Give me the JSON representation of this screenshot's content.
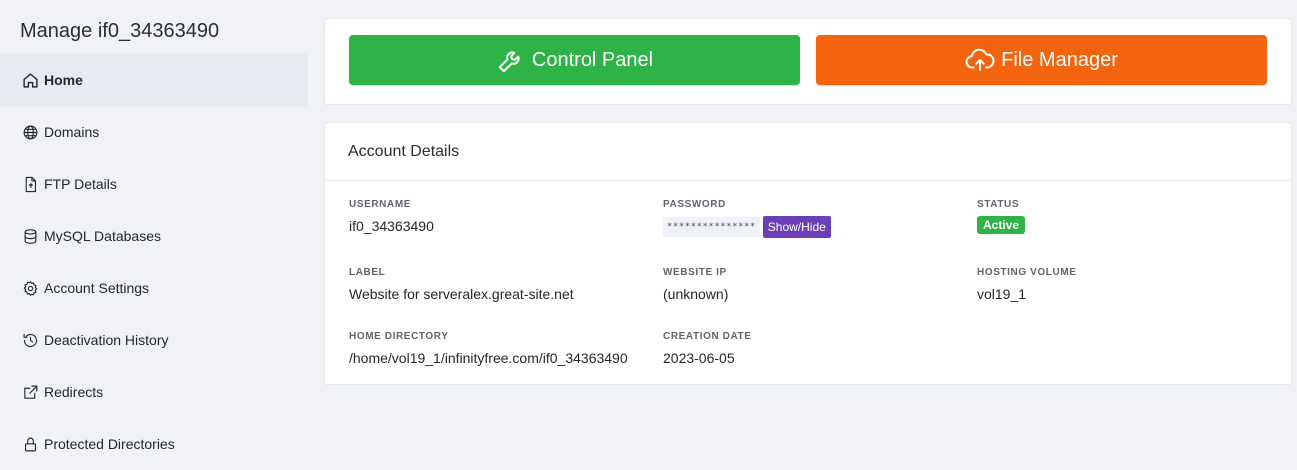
{
  "sidebar": {
    "title": "Manage if0_34363490",
    "items": [
      {
        "label": "Home",
        "icon": "home-icon"
      },
      {
        "label": "Domains",
        "icon": "globe-icon"
      },
      {
        "label": "FTP Details",
        "icon": "file-upload-icon"
      },
      {
        "label": "MySQL Databases",
        "icon": "database-icon"
      },
      {
        "label": "Account Settings",
        "icon": "gear-icon"
      },
      {
        "label": "Deactivation History",
        "icon": "history-icon"
      },
      {
        "label": "Redirects",
        "icon": "external-link-icon"
      },
      {
        "label": "Protected Directories",
        "icon": "lock-icon"
      }
    ]
  },
  "actions": {
    "control_panel": "Control Panel",
    "file_manager": "File Manager",
    "control_panel_color": "#2eb347",
    "file_manager_color": "#f2650e"
  },
  "details": {
    "title": "Account Details",
    "username_label": "USERNAME",
    "username": "if0_34363490",
    "password_label": "PASSWORD",
    "password_mask": "***************",
    "show_hide": "Show/Hide",
    "status_label": "STATUS",
    "status": "Active",
    "label_label": "LABEL",
    "label": "Website for serveralex.great-site.net",
    "website_ip_label": "WEBSITE IP",
    "website_ip": "(unknown)",
    "hosting_volume_label": "HOSTING VOLUME",
    "hosting_volume": "vol19_1",
    "home_directory_label": "HOME DIRECTORY",
    "home_directory": "/home/vol19_1/infinityfree.com/if0_34363490",
    "creation_date_label": "CREATION DATE",
    "creation_date": "2023-06-05"
  }
}
